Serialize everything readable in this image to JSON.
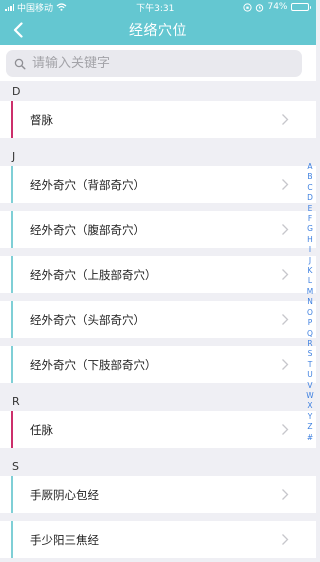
{
  "status": {
    "carrier": "中国移动",
    "time": "下午3:31",
    "battery": "74%",
    "battery_level": 0.74
  },
  "nav": {
    "title": "经络穴位"
  },
  "search": {
    "placeholder": "请输入关键字"
  },
  "colors": {
    "header": "#64c7d1",
    "accent_teal": "#7fcfd6",
    "accent_magenta": "#cc2f6b",
    "index_blue": "#3c7fe0"
  },
  "sections": [
    {
      "letter": "D",
      "items": [
        {
          "label": "督脉",
          "accent": "magenta"
        }
      ]
    },
    {
      "letter": "J",
      "items": [
        {
          "label": "经外奇穴（背部奇穴）",
          "accent": "teal"
        },
        {
          "label": "经外奇穴（腹部奇穴）",
          "accent": "teal"
        },
        {
          "label": "经外奇穴（上肢部奇穴）",
          "accent": "teal"
        },
        {
          "label": "经外奇穴（头部奇穴）",
          "accent": "teal"
        },
        {
          "label": "经外奇穴（下肢部奇穴）",
          "accent": "teal"
        }
      ]
    },
    {
      "letter": "R",
      "items": [
        {
          "label": "任脉",
          "accent": "magenta"
        }
      ]
    },
    {
      "letter": "S",
      "items": [
        {
          "label": "手厥阴心包经",
          "accent": "teal"
        },
        {
          "label": "手少阳三焦经",
          "accent": "teal"
        }
      ]
    }
  ],
  "index_letters": [
    "A",
    "B",
    "C",
    "D",
    "E",
    "F",
    "G",
    "H",
    "I",
    "J",
    "K",
    "L",
    "M",
    "N",
    "O",
    "P",
    "Q",
    "R",
    "S",
    "T",
    "U",
    "V",
    "W",
    "X",
    "Y",
    "Z",
    "#"
  ]
}
